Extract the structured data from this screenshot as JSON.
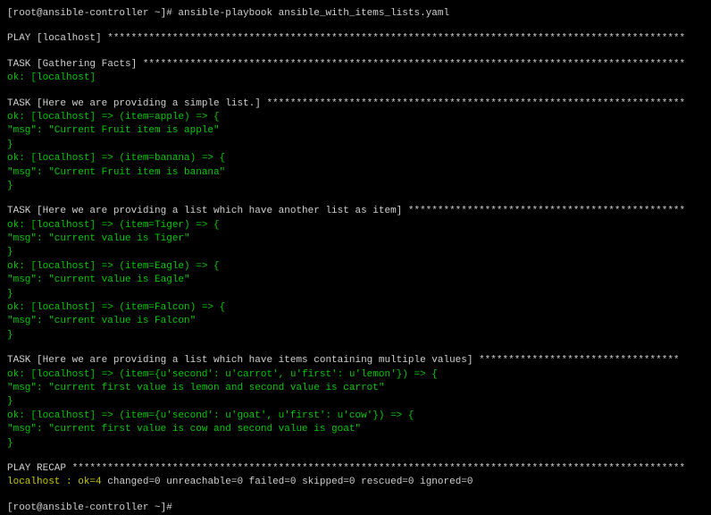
{
  "prompt": "[root@ansible-controller ~]# ansible-playbook  ansible_with_items_lists.yaml",
  "play_header": "PLAY [localhost] **************************************************************************************************",
  "task_gathering_header": "TASK [Gathering Facts] ********************************************************************************************",
  "gathering_ok": "ok: [localhost]",
  "task1_header": "TASK [Here we are providing a simple list.] ***********************************************************************",
  "task1_line1": "ok: [localhost] => (item=apple) => {",
  "task1_msg1": "    \"msg\": \"Current Fruit item is apple\"",
  "task1_close1": "}",
  "task1_line2": "ok: [localhost] => (item=banana) => {",
  "task1_msg2": "    \"msg\": \"Current Fruit item is banana\"",
  "task1_close2": "}",
  "task2_header": "TASK [Here we are providing a list which have another list as item] ***********************************************",
  "task2_line1": "ok: [localhost] => (item=Tiger) => {",
  "task2_msg1": "    \"msg\": \"current value is Tiger\"",
  "task2_close1": "}",
  "task2_line2": "ok: [localhost] => (item=Eagle) => {",
  "task2_msg2": "    \"msg\": \"current value is Eagle\"",
  "task2_close2": "}",
  "task2_line3": "ok: [localhost] => (item=Falcon) => {",
  "task2_msg3": "    \"msg\": \"current value is Falcon\"",
  "task2_close3": "}",
  "task3_header": "TASK [Here we are providing a list which have items containing multiple values] **********************************",
  "task3_line1": "ok: [localhost] => (item={u'second': u'carrot', u'first': u'lemon'}) => {",
  "task3_msg1": "    \"msg\": \"current first value is lemon and second value is carrot\"",
  "task3_close1": "}",
  "task3_line2": "ok: [localhost] => (item={u'second': u'goat', u'first': u'cow'}) => {",
  "task3_msg2": "    \"msg\": \"current first value is cow and second value is goat\"",
  "task3_close2": "}",
  "recap_header": "PLAY RECAP ********************************************************************************************************",
  "recap_host": "localhost",
  "recap_ok": ": ok=4   ",
  "recap_rest": "changed=0    unreachable=0    failed=0    skipped=0    rescued=0    ignored=0",
  "final_prompt": "[root@ansible-controller ~]#"
}
